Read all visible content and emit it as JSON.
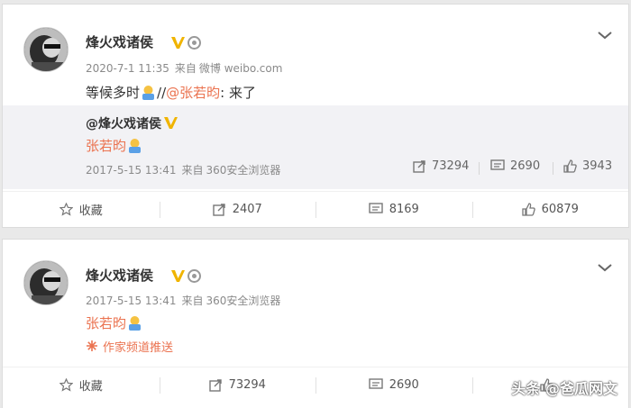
{
  "accent_color": "#eb7350",
  "verified_color": "#f0b400",
  "post1": {
    "author": "烽火戏诸侯",
    "timestamp": "2020-7-1 11:35",
    "source_prefix": "来自",
    "source": "微博 weibo.com",
    "text_before": "等候多时",
    "text_sep": "//",
    "mention": "@张若昀",
    "text_after": ": 来了",
    "repost": {
      "author": "@烽火戏诸侯",
      "text": "张若昀",
      "timestamp": "2017-5-15 13:41",
      "source_prefix": "来自",
      "source": "360安全浏览器",
      "forward_count": "73294",
      "comment_count": "2690",
      "like_count": "3943"
    },
    "actions": {
      "favorite_label": "收藏",
      "forward_count": "2407",
      "comment_count": "8169",
      "like_count": "60879"
    }
  },
  "post2": {
    "author": "烽火戏诸侯",
    "timestamp": "2017-5-15 13:41",
    "source_prefix": "来自",
    "source": "360安全浏览器",
    "text": "张若昀",
    "push_label": "作家频道推送",
    "actions": {
      "favorite_label": "收藏",
      "forward_count": "73294",
      "comment_count": "2690"
    }
  },
  "watermark": "头条 @爸瓜网文",
  "icons": [
    "avatar",
    "verified-v-icon",
    "medal-icon",
    "chevron-down-icon",
    "emoji-icon",
    "star-icon",
    "share-icon",
    "comment-icon",
    "like-icon",
    "spark-icon"
  ]
}
